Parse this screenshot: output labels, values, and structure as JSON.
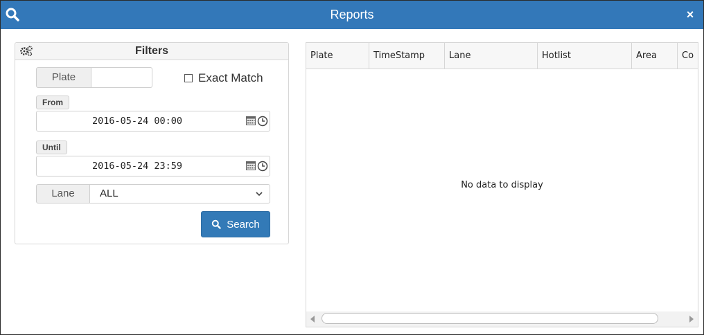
{
  "window": {
    "title": "Reports",
    "close_label": "×"
  },
  "filters": {
    "title": "Filters",
    "plate_label": "Plate",
    "plate_value": "",
    "exact_match_label": "Exact Match",
    "exact_match_checked": false,
    "from_label": "From",
    "from_value": "2016-05-24  00:00",
    "until_label": "Until",
    "until_value": "2016-05-24  23:59",
    "lane_label": "Lane",
    "lane_value": "ALL",
    "search_label": "Search"
  },
  "grid": {
    "columns": [
      "Plate",
      "TimeStamp",
      "Lane",
      "Hotlist",
      "Area",
      "Co"
    ],
    "rows": [],
    "empty_text": "No data to display"
  },
  "colors": {
    "accent": "#3378b9",
    "button": "#337ab7"
  }
}
